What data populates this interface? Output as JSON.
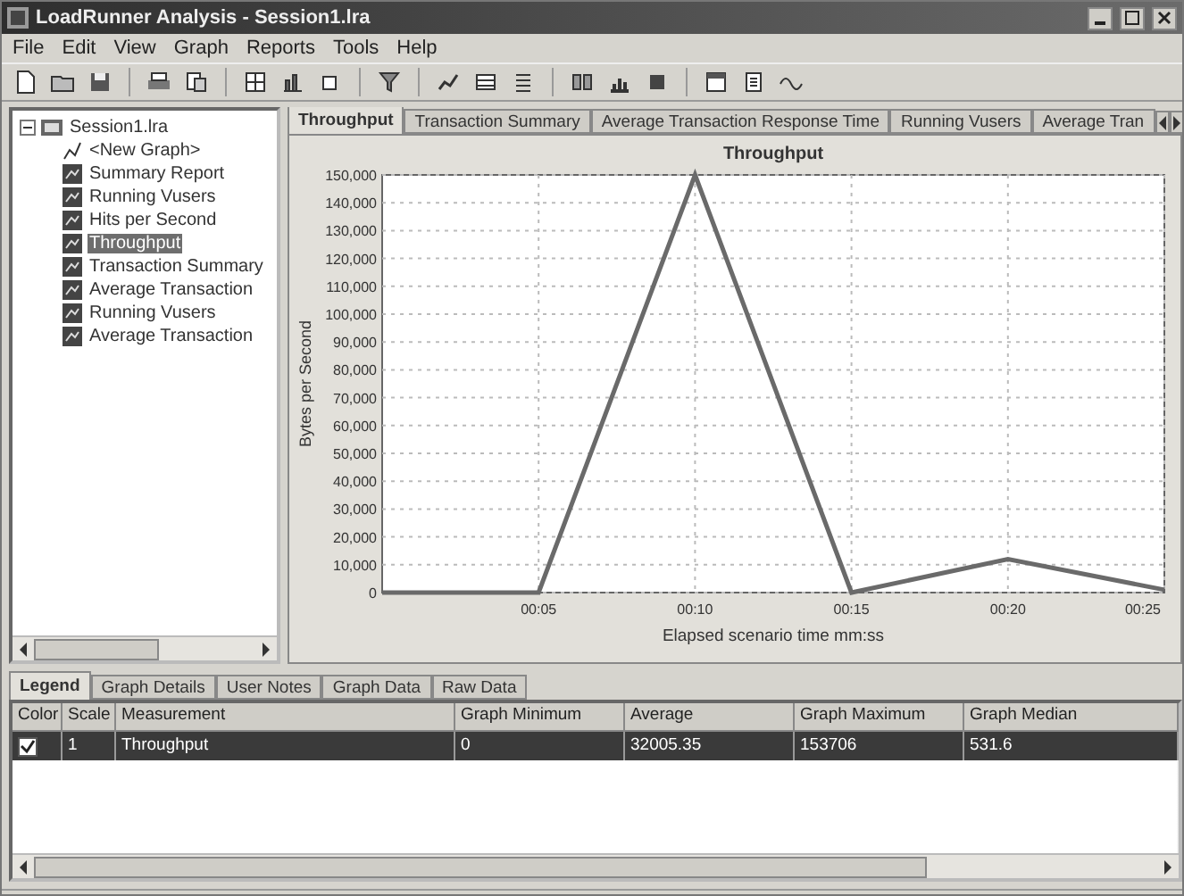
{
  "window": {
    "title": "LoadRunner Analysis - Session1.lra"
  },
  "menu": [
    "File",
    "Edit",
    "View",
    "Graph",
    "Reports",
    "Tools",
    "Help"
  ],
  "tree": {
    "label": "Session1.lra",
    "expanded": true,
    "children": [
      {
        "label": "<New Graph>",
        "kind": "new",
        "selected": false
      },
      {
        "label": "Summary Report",
        "kind": "graph",
        "selected": false
      },
      {
        "label": "Running Vusers",
        "kind": "graph",
        "selected": false
      },
      {
        "label": "Hits per Second",
        "kind": "graph",
        "selected": false
      },
      {
        "label": "Throughput",
        "kind": "graph",
        "selected": true
      },
      {
        "label": "Transaction Summary",
        "kind": "graph",
        "selected": false
      },
      {
        "label": "Average Transaction",
        "kind": "graph",
        "selected": false
      },
      {
        "label": "Running Vusers",
        "kind": "graph",
        "selected": false
      },
      {
        "label": "Average Transaction",
        "kind": "graph",
        "selected": false
      }
    ]
  },
  "graph_tabs": [
    {
      "label": "Throughput",
      "selected": true
    },
    {
      "label": "Transaction Summary",
      "selected": false
    },
    {
      "label": "Average Transaction Response Time",
      "selected": false
    },
    {
      "label": "Running Vusers",
      "selected": false
    },
    {
      "label": "Average Tran",
      "selected": false
    }
  ],
  "chart": {
    "chart_data": {
      "type": "line",
      "title": "Throughput",
      "xlabel": "Elapsed scenario time mm:ss",
      "ylabel": "Bytes per Second",
      "x": [
        0,
        5,
        10,
        15,
        20,
        25
      ],
      "xlim": [
        0,
        25
      ],
      "ylim": [
        0,
        150000
      ],
      "xticks": [
        {
          "value": 5,
          "label": "00:05"
        },
        {
          "value": 10,
          "label": "00:10"
        },
        {
          "value": 15,
          "label": "00:15"
        },
        {
          "value": 20,
          "label": "00:20"
        },
        {
          "value": 25,
          "label": "00:25"
        }
      ],
      "yticks": [
        {
          "value": 0,
          "label": "0"
        },
        {
          "value": 10000,
          "label": "10,000"
        },
        {
          "value": 20000,
          "label": "20,000"
        },
        {
          "value": 30000,
          "label": "30,000"
        },
        {
          "value": 40000,
          "label": "40,000"
        },
        {
          "value": 50000,
          "label": "50,000"
        },
        {
          "value": 60000,
          "label": "60,000"
        },
        {
          "value": 70000,
          "label": "70,000"
        },
        {
          "value": 80000,
          "label": "80,000"
        },
        {
          "value": 90000,
          "label": "90,000"
        },
        {
          "value": 100000,
          "label": "100,000"
        },
        {
          "value": 110000,
          "label": "110,000"
        },
        {
          "value": 120000,
          "label": "120,000"
        },
        {
          "value": 130000,
          "label": "130,000"
        },
        {
          "value": 140000,
          "label": "140,000"
        },
        {
          "value": 150000,
          "label": "150,000"
        }
      ],
      "grid": true,
      "series": [
        {
          "color": "#6a6a6a",
          "values": [
            0,
            0,
            150000,
            0,
            12000,
            1000
          ]
        }
      ]
    }
  },
  "bottom_tabs": [
    {
      "label": "Legend",
      "selected": true
    },
    {
      "label": "Graph Details",
      "selected": false
    },
    {
      "label": "User Notes",
      "selected": false
    },
    {
      "label": "Graph Data",
      "selected": false
    },
    {
      "label": "Raw Data",
      "selected": false
    }
  ],
  "legend_table": {
    "columns": [
      "Color",
      "Scale",
      "Measurement",
      "Graph Minimum",
      "Average",
      "Graph Maximum",
      "Graph Median"
    ],
    "rows": [
      {
        "checked": true,
        "selected": true,
        "cells": [
          "",
          "1",
          "Throughput",
          "0",
          "32005.35",
          "153706",
          "531.6"
        ]
      }
    ]
  }
}
